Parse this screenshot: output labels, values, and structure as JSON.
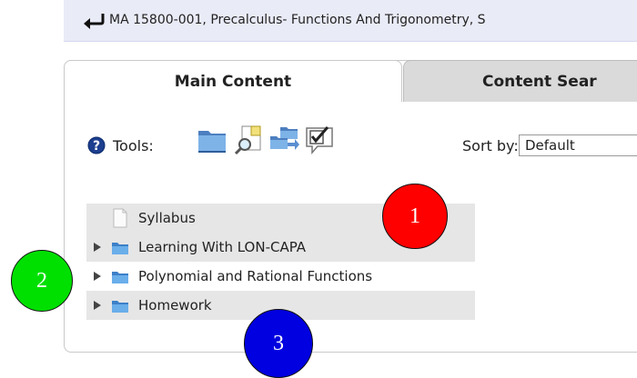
{
  "breadcrumb": {
    "icon": "return-arrow-icon",
    "text": "MA 15800-001, Precalculus- Functions And Trigonometry, S"
  },
  "tabs": {
    "main": "Main Content",
    "search": "Content Sear"
  },
  "tools": {
    "label": "Tools:",
    "icons": [
      "help-icon",
      "folder-icon",
      "document-search-icon",
      "folders-icon",
      "checkbox-icon"
    ]
  },
  "sort": {
    "label": "Sort by:",
    "value": "Default"
  },
  "content_items": [
    {
      "label": "Syllabus",
      "type": "document"
    },
    {
      "label": "Learning With LON-CAPA",
      "type": "folder"
    },
    {
      "label": "Polynomial and Rational Functions",
      "type": "folder"
    },
    {
      "label": "Homework",
      "type": "folder"
    }
  ],
  "markers": [
    {
      "label": "1",
      "color": "#ff0000"
    },
    {
      "label": "2",
      "color": "#00e000"
    },
    {
      "label": "3",
      "color": "#0000e0"
    }
  ]
}
